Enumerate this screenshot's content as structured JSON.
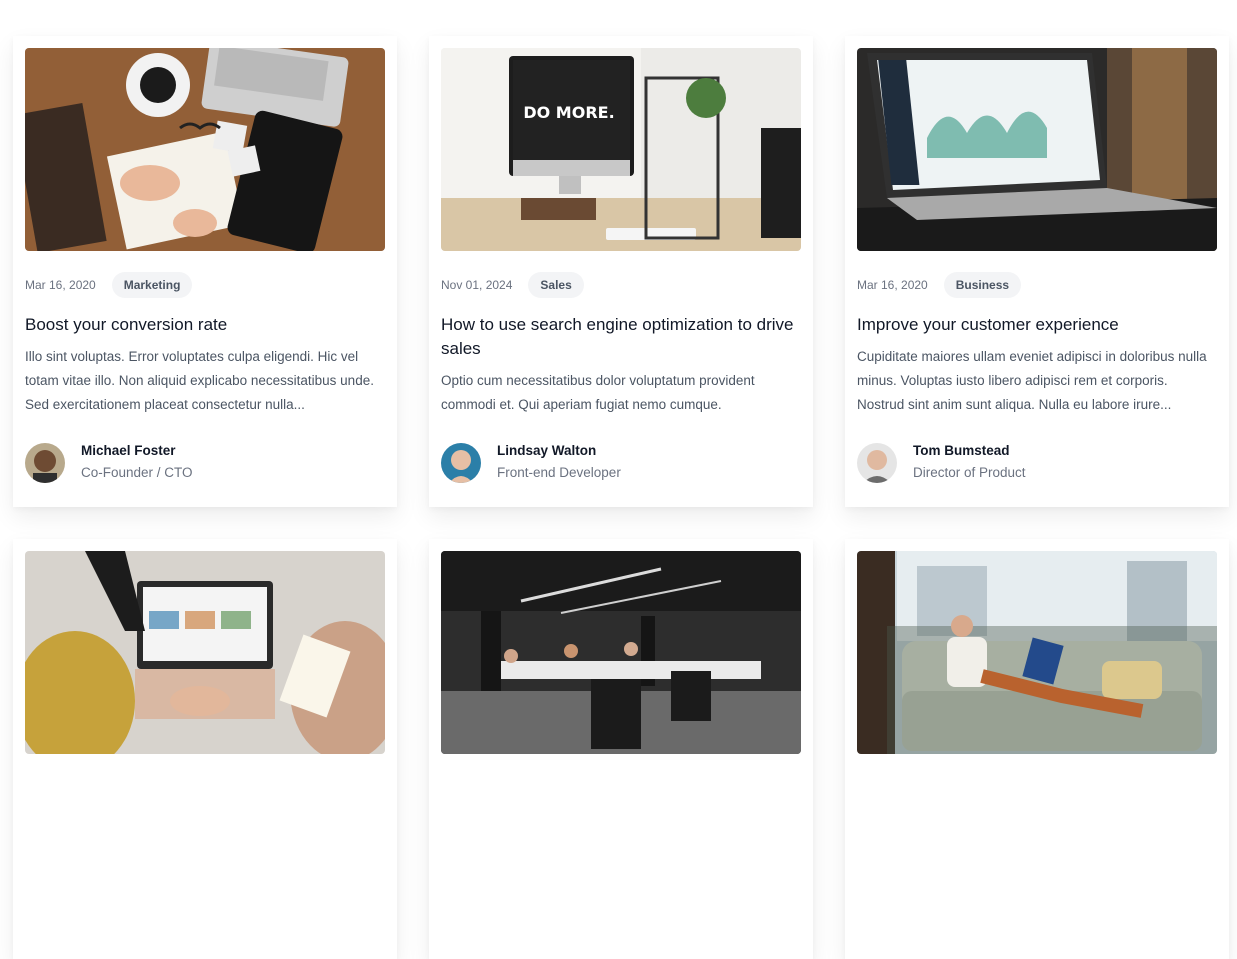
{
  "posts": [
    {
      "date": "Mar 16, 2020",
      "category": "Marketing",
      "title": "Boost your conversion rate",
      "excerpt": "Illo sint voluptas. Error voluptates culpa eligendi. Hic vel totam vitae illo. Non aliquid explicabo necessitatibus unde. Sed exercitationem placeat consectetur nulla...",
      "author": {
        "name": "Michael Foster",
        "role": "Co-Founder / CTO"
      }
    },
    {
      "date": "Nov 01, 2024",
      "category": "Sales",
      "title": "How to use search engine optimization to drive sales",
      "excerpt": "Optio cum necessitatibus dolor voluptatum provident commodi et. Qui aperiam fugiat nemo cumque.",
      "author": {
        "name": "Lindsay Walton",
        "role": "Front-end Developer"
      },
      "image_text": "DO MORE."
    },
    {
      "date": "Mar 16, 2020",
      "category": "Business",
      "title": "Improve your customer experience",
      "excerpt": "Cupiditate maiores ullam eveniet adipisci in doloribus nulla minus. Voluptas iusto libero adipisci rem et corporis. Nostrud sint anim sunt aliqua. Nulla eu labore irure...",
      "author": {
        "name": "Tom Bumstead",
        "role": "Director of Product"
      }
    }
  ]
}
